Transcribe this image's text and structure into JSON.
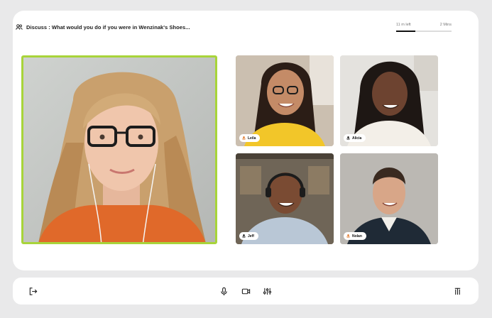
{
  "session": {
    "topic_text": "Discuss : What would you do if you were in Wenzinak's Shoes...",
    "timer": {
      "elapsed_label": "11 m left",
      "total_label": "2 Mins",
      "progress": 0.35
    }
  },
  "participants": [
    {
      "name": "",
      "role": "active-speaker"
    },
    {
      "name": "Leila"
    },
    {
      "name": "Alicia"
    },
    {
      "name": "Jeff"
    },
    {
      "name": "Nolan"
    }
  ],
  "colors": {
    "active_speaker_border": "#a8d43a",
    "mic_accent": "#e07a2d",
    "background": "#e9e9ea"
  },
  "toolbar": {
    "icons": [
      "exit-icon",
      "microphone-icon",
      "camera-icon",
      "settings-sliders-icon",
      "more-options-icon"
    ]
  }
}
